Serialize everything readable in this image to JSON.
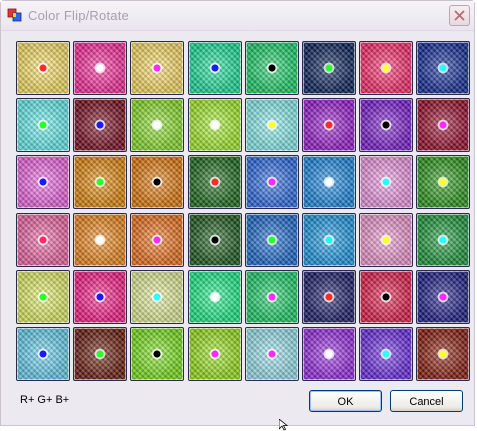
{
  "window": {
    "title": "Color Flip/Rotate"
  },
  "grid": {
    "rows": 6,
    "cols": 8,
    "tiles": [
      [
        "#ffe566",
        "#ff2a9e",
        "#ffe066",
        "#19e39b",
        "#19d36a",
        "#06205a",
        "#ff2a6a",
        "#0f2a9a"
      ],
      [
        "#66f2f2",
        "#7a0a1e",
        "#8ae32a",
        "#a6f22a",
        "#8af2f2",
        "#9a1ad2",
        "#7a1ad2",
        "#9a0a2a"
      ],
      [
        "#f266e6",
        "#e6890a",
        "#e67a0a",
        "#1a6a1a",
        "#2a6ae6",
        "#1a8ae6",
        "#f29ae6",
        "#2a9a1a"
      ],
      [
        "#f266a6",
        "#f28a1a",
        "#f2721a",
        "#1a5a1a",
        "#1a6ad2",
        "#1a9ae6",
        "#f29ad2",
        "#1a9a3a"
      ],
      [
        "#e6f266",
        "#ff1a8a",
        "#e6f29a",
        "#1af28a",
        "#1ad26a",
        "#1a1a6a",
        "#e61a4a",
        "#1a1a8a"
      ],
      [
        "#66d2f2",
        "#6a1a0a",
        "#7ae61a",
        "#9ae61a",
        "#9ae6f2",
        "#9a2ae6",
        "#6a2ae6",
        "#8a1a0a"
      ]
    ],
    "centers": [
      [
        "#ff2a2a",
        "#ffffff",
        "#ff2aff",
        "#1a1aff",
        "#000000",
        "#2aff2a",
        "#ffff2a",
        "#2affff"
      ],
      [
        "#2aff2a",
        "#1a1aff",
        "#ffffff",
        "#ffffff",
        "#ffff2a",
        "#ff2a2a",
        "#000000",
        "#ff2aff"
      ],
      [
        "#1a1aff",
        "#2aff2a",
        "#000000",
        "#ff2a2a",
        "#ff2aff",
        "#ffffff",
        "#2affff",
        "#ffff2a"
      ],
      [
        "#ff2a6a",
        "#ffffff",
        "#ff2aff",
        "#000000",
        "#2aff2a",
        "#1affff",
        "#ffff2a",
        "#2affff"
      ],
      [
        "#2aff2a",
        "#1a1aff",
        "#2affff",
        "#ffffff",
        "#ff2aff",
        "#ff2a2a",
        "#000000",
        "#ff2aff"
      ],
      [
        "#1a1aff",
        "#2aff2a",
        "#000000",
        "#ff2aff",
        "#ff2aff",
        "#ffffff",
        "#2affff",
        "#ffff2a"
      ]
    ]
  },
  "status": {
    "channels": "R+ G+ B+"
  },
  "buttons": {
    "ok": "OK",
    "cancel": "Cancel"
  }
}
